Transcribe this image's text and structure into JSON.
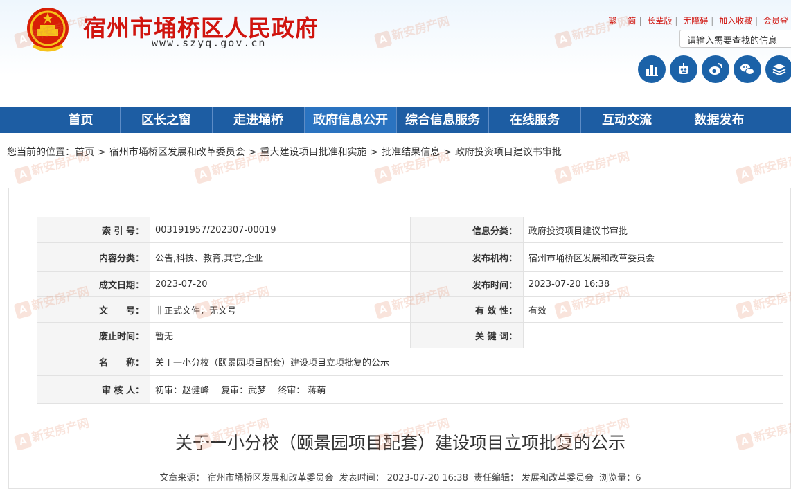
{
  "header": {
    "site_title": "宿州市埇桥区人民政府",
    "site_url": "www.szyq.gov.cn",
    "top_links": [
      "繁",
      "简",
      "长辈版",
      "无障碍",
      "加入收藏",
      "会员登"
    ],
    "search_placeholder": "请输入需要查找的信息",
    "circle_icons": [
      "bar-chart-icon",
      "robot-icon",
      "weibo-icon",
      "wechat-icon",
      "layers-icon"
    ],
    "brand_color": "#d0140e",
    "nav_color": "#1d5da3"
  },
  "nav": {
    "items": [
      "首页",
      "区长之窗",
      "走进埇桥",
      "政府信息公开",
      "综合信息服务",
      "在线服务",
      "互动交流",
      "数据发布"
    ],
    "active": "政府信息公开"
  },
  "breadcrumb": {
    "prefix": "您当前的位置：",
    "items": [
      "首页",
      "宿州市埇桥区发展和改革委员会",
      "重大建设项目批准和实施",
      "批准结果信息",
      "政府投资项目建议书审批"
    ]
  },
  "meta": {
    "index_label": "索 引 号：",
    "index_value": "003191957/202307-00019",
    "category_label": "信息分类：",
    "category_value": "政府投资项目建议书审批",
    "content_cat_label": "内容分类：",
    "content_cat_value": "公告,科技、教育,其它,企业",
    "publisher_label": "发布机构：",
    "publisher_value": "宿州市埇桥区发展和改革委员会",
    "date_label": "成文日期：",
    "date_value": "2023-07-20",
    "pub_time_label": "发布时间：",
    "pub_time_value": "2023-07-20 16:38",
    "doc_no_label": "文　　号：",
    "doc_no_value": "非正式文件，无文号",
    "validity_label": "有 效 性：",
    "validity_value": "有效",
    "abolish_label": "废止时间：",
    "abolish_value": "暂无",
    "keywords_label": "关 键 词：",
    "keywords_value": "",
    "name_label": "名　　称：",
    "name_value": "关于一小分校（颐景园项目配套）建设项目立项批复的公示",
    "review_label": "审 核 人：",
    "review_value": "初审：赵健峰　 复审：武梦　 终审： 蒋萌"
  },
  "article": {
    "title": "关于一小分校（颐景园项目配套）建设项目立项批复的公示",
    "source_label": "文章来源：",
    "source_value": "宿州市埇桥区发展和改革委员会",
    "time_label": "发表时间：",
    "time_value": "2023-07-20 16:38",
    "editor_label": "责任编辑：",
    "editor_value": "发展和改革委员会",
    "views_label": "浏览量：",
    "views_value": "6"
  },
  "watermark": {
    "text": "新安房产网",
    "logo": "A"
  }
}
